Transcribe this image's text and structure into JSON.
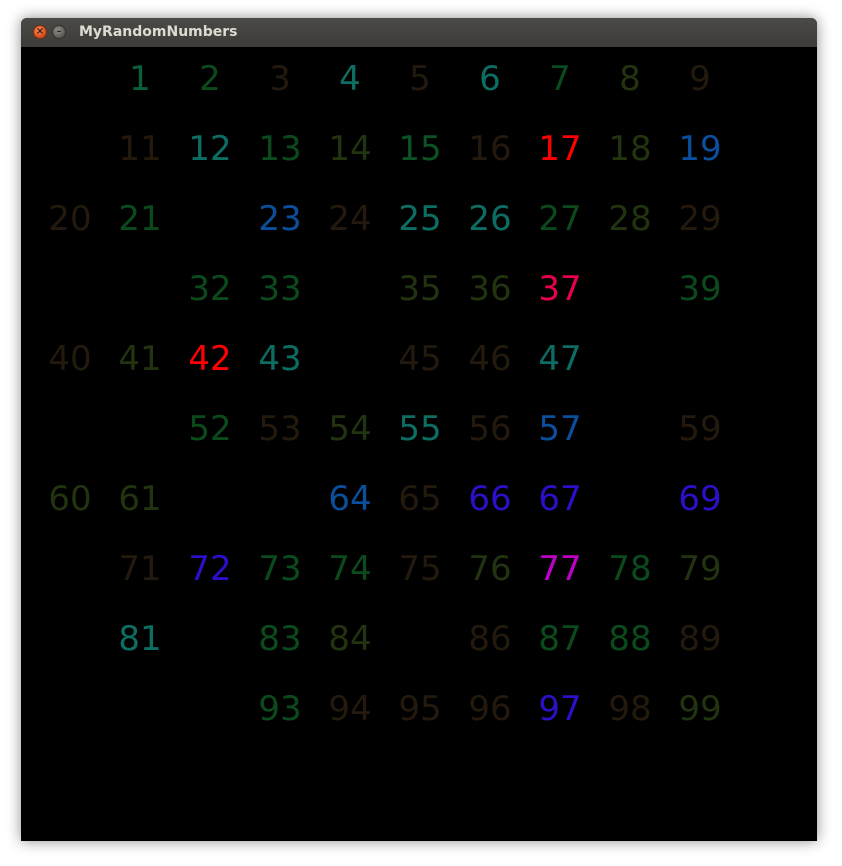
{
  "window": {
    "title": "MyRandomNumbers",
    "close_glyph": "×",
    "minimize_glyph": "–",
    "background_color": "#000000"
  },
  "numbers": [
    {
      "text": "1",
      "color": "#0b5e3a"
    },
    {
      "text": "2",
      "color": "#0b4a1c"
    },
    {
      "text": "3",
      "color": "#231a0d"
    },
    {
      "text": "4",
      "color": "#0c6d62"
    },
    {
      "text": "5",
      "color": "#231a0d"
    },
    {
      "text": "6",
      "color": "#0c6d62"
    },
    {
      "text": "7",
      "color": "#0b4a1c"
    },
    {
      "text": "8",
      "color": "#22330f"
    },
    {
      "text": "9",
      "color": "#231a0d"
    },
    {
      "text": "11",
      "color": "#231a0d"
    },
    {
      "text": "12",
      "color": "#0c6d62"
    },
    {
      "text": "13",
      "color": "#0b4a1c"
    },
    {
      "text": "14",
      "color": "#22330f"
    },
    {
      "text": "15",
      "color": "#0b5224"
    },
    {
      "text": "16",
      "color": "#231a0d"
    },
    {
      "text": "17",
      "color": "#ff0000"
    },
    {
      "text": "18",
      "color": "#22330f"
    },
    {
      "text": "19",
      "color": "#0a4e9c"
    },
    {
      "text": "20",
      "color": "#231a0d"
    },
    {
      "text": "21",
      "color": "#0b4a1c"
    },
    {
      "text": "23",
      "color": "#0a4e9c"
    },
    {
      "text": "24",
      "color": "#231a0d"
    },
    {
      "text": "25",
      "color": "#0c6d62"
    },
    {
      "text": "26",
      "color": "#0c6d62"
    },
    {
      "text": "27",
      "color": "#0b4a1c"
    },
    {
      "text": "28",
      "color": "#22330f"
    },
    {
      "text": "29",
      "color": "#231a0d"
    },
    {
      "text": "32",
      "color": "#0b4a1c"
    },
    {
      "text": "33",
      "color": "#0b4a1c"
    },
    {
      "text": "35",
      "color": "#22330f"
    },
    {
      "text": "36",
      "color": "#22330f"
    },
    {
      "text": "37",
      "color": "#e8004a"
    },
    {
      "text": "39",
      "color": "#0b4a1c"
    },
    {
      "text": "40",
      "color": "#231a0d"
    },
    {
      "text": "41",
      "color": "#22330f"
    },
    {
      "text": "42",
      "color": "#ff0000"
    },
    {
      "text": "43",
      "color": "#0c6d62"
    },
    {
      "text": "45",
      "color": "#231a0d"
    },
    {
      "text": "46",
      "color": "#231a0d"
    },
    {
      "text": "47",
      "color": "#0c6d62"
    },
    {
      "text": "52",
      "color": "#0b4a1c"
    },
    {
      "text": "53",
      "color": "#231a0d"
    },
    {
      "text": "54",
      "color": "#22330f"
    },
    {
      "text": "55",
      "color": "#0c6d62"
    },
    {
      "text": "56",
      "color": "#231a0d"
    },
    {
      "text": "57",
      "color": "#0a4e9c"
    },
    {
      "text": "59",
      "color": "#231a0d"
    },
    {
      "text": "60",
      "color": "#22330f"
    },
    {
      "text": "61",
      "color": "#22330f"
    },
    {
      "text": "64",
      "color": "#0a4e9c"
    },
    {
      "text": "65",
      "color": "#231a0d"
    },
    {
      "text": "66",
      "color": "#2a10c8"
    },
    {
      "text": "67",
      "color": "#2a10c8"
    },
    {
      "text": "69",
      "color": "#2a10c8"
    },
    {
      "text": "71",
      "color": "#231a0d"
    },
    {
      "text": "72",
      "color": "#2a10c8"
    },
    {
      "text": "73",
      "color": "#0b4a1c"
    },
    {
      "text": "74",
      "color": "#0b4a1c"
    },
    {
      "text": "75",
      "color": "#231a0d"
    },
    {
      "text": "76",
      "color": "#22330f"
    },
    {
      "text": "77",
      "color": "#c000c8"
    },
    {
      "text": "78",
      "color": "#0b4a1c"
    },
    {
      "text": "79",
      "color": "#22330f"
    },
    {
      "text": "81",
      "color": "#0c6d62"
    },
    {
      "text": "83",
      "color": "#0b4a1c"
    },
    {
      "text": "84",
      "color": "#22330f"
    },
    {
      "text": "86",
      "color": "#231a0d"
    },
    {
      "text": "87",
      "color": "#0b4a1c"
    },
    {
      "text": "88",
      "color": "#0b4a1c"
    },
    {
      "text": "89",
      "color": "#231a0d"
    },
    {
      "text": "93",
      "color": "#0b4a1c"
    },
    {
      "text": "94",
      "color": "#231a0d"
    },
    {
      "text": "95",
      "color": "#231a0d"
    },
    {
      "text": "96",
      "color": "#231a0d"
    },
    {
      "text": "97",
      "color": "#2a10c8"
    },
    {
      "text": "98",
      "color": "#231a0d"
    },
    {
      "text": "99",
      "color": "#22330f"
    }
  ]
}
